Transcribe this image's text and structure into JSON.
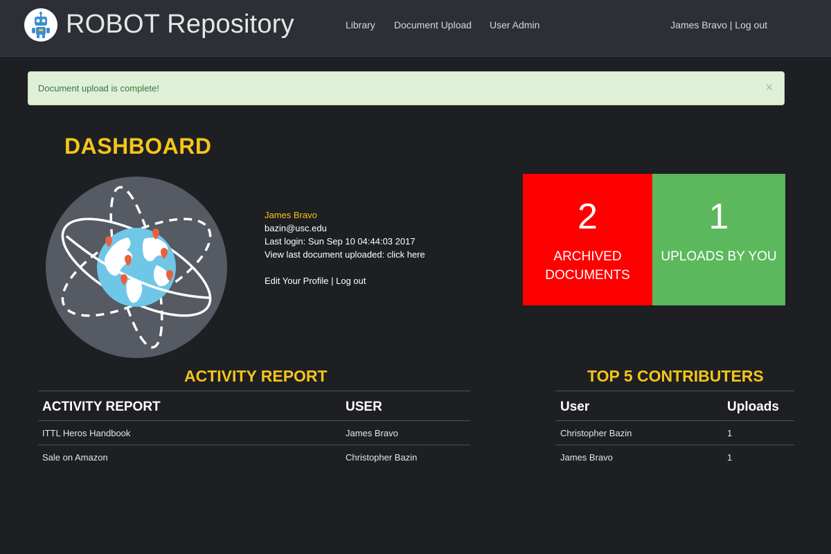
{
  "colors": {
    "accent_yellow": "#f5c518",
    "archived_red": "#ff0000",
    "uploads_green": "#5cb85c",
    "alert_bg": "#dff0d8",
    "navbar_bg": "#2c2f35",
    "page_bg": "#1d1f23"
  },
  "nav": {
    "brand": "ROBOT Repository",
    "logo_icon": "robot-icon",
    "links": [
      "Library",
      "Document Upload",
      "User Admin"
    ],
    "user_name": "James Bravo",
    "separator": " | ",
    "logout": "Log out"
  },
  "alert": {
    "message": "Document upload is complete!",
    "close": "×"
  },
  "dashboard": {
    "title": "DASHBOARD",
    "illustration_icon": "globe-orbit-icon"
  },
  "profile": {
    "name": "James Bravo",
    "email": "bazin@usc.edu",
    "last_login_label": "Last login: ",
    "last_login_value": "Sun Sep 10 04:44:03 2017",
    "last_doc_label": "View last document uploaded: ",
    "last_doc_link": "click here",
    "edit_profile": "Edit Your Profile",
    "separator": " | ",
    "logout": "Log out"
  },
  "stats": {
    "archived_count": "2",
    "archived_label_1": "ARCHIVED",
    "archived_label_2": "DOCUMENTS",
    "uploads_count": "1",
    "uploads_label": "UPLOADS BY YOU"
  },
  "activity": {
    "title": "ACTIVITY REPORT",
    "headers": [
      "ACTIVITY REPORT",
      "USER"
    ],
    "rows": [
      [
        "ITTL Heros Handbook",
        "James Bravo"
      ],
      [
        "Sale on Amazon",
        "Christopher Bazin"
      ]
    ]
  },
  "contributors": {
    "title": "TOP 5 CONTRIBUTERS",
    "headers": [
      "User",
      "Uploads"
    ],
    "rows": [
      [
        "Christopher Bazin",
        "1"
      ],
      [
        "James Bravo",
        "1"
      ]
    ]
  }
}
